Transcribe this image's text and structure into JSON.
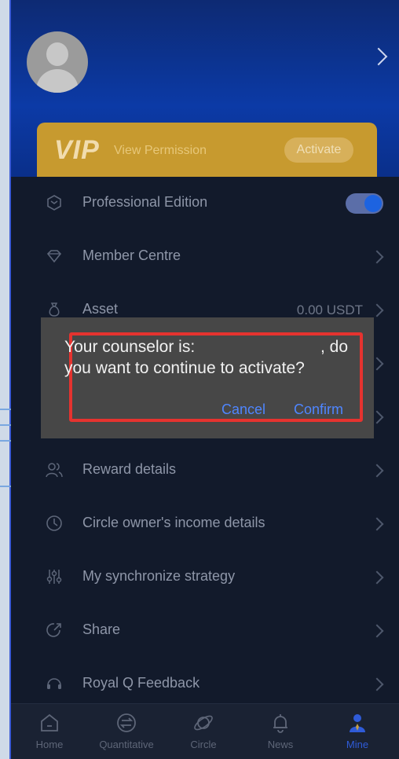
{
  "vip": {
    "logo": "VIP",
    "permission": "View Permission",
    "activate": "Activate"
  },
  "menu": {
    "professional": "Professional Edition",
    "member": "Member Centre",
    "asset": "Asset",
    "asset_value": "0.00 USDT",
    "reward": "Reward details",
    "circle_income": "Circle owner's income details",
    "sync": "My synchronize strategy",
    "share": "Share",
    "feedback": "Royal Q Feedback"
  },
  "dialog": {
    "line1": "Your counselor is:",
    "line1_end": ", do",
    "line2": "you want to continue to activate?",
    "cancel": "Cancel",
    "confirm": "Confirm"
  },
  "tabs": [
    {
      "label": "Home"
    },
    {
      "label": "Quantitative"
    },
    {
      "label": "Circle"
    },
    {
      "label": "News"
    },
    {
      "label": "Mine"
    }
  ],
  "colors": {
    "accent": "#4f86ff",
    "vip_gold": "#c79a2f",
    "highlight_border": "#e5332f"
  }
}
